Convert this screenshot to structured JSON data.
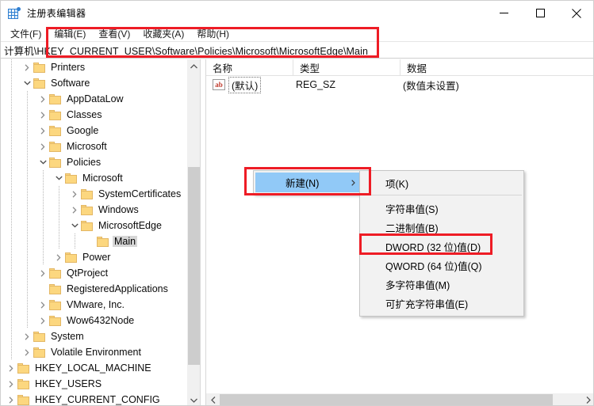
{
  "window": {
    "title": "注册表编辑器",
    "icon": "registry-editor-icon",
    "minimize": "–",
    "maximize": "□",
    "close": "✕"
  },
  "menubar": {
    "items": [
      {
        "label": "文件(F)",
        "name": "menu-file"
      },
      {
        "label": "编辑(E)",
        "name": "menu-edit"
      },
      {
        "label": "查看(V)",
        "name": "menu-view"
      },
      {
        "label": "收藏夹(A)",
        "name": "menu-favorites"
      },
      {
        "label": "帮助(H)",
        "name": "menu-help"
      }
    ]
  },
  "address": {
    "path": "计算机\\HKEY_CURRENT_USER\\Software\\Policies\\Microsoft\\MicrosoftEdge\\Main"
  },
  "tree": {
    "nodes": [
      {
        "label": "Printers",
        "depth": 2,
        "twist": "collapsed",
        "selected": false
      },
      {
        "label": "Software",
        "depth": 2,
        "twist": "expanded",
        "selected": false
      },
      {
        "label": "AppDataLow",
        "depth": 3,
        "twist": "collapsed",
        "selected": false
      },
      {
        "label": "Classes",
        "depth": 3,
        "twist": "collapsed",
        "selected": false
      },
      {
        "label": "Google",
        "depth": 3,
        "twist": "collapsed",
        "selected": false
      },
      {
        "label": "Microsoft",
        "depth": 3,
        "twist": "collapsed",
        "selected": false
      },
      {
        "label": "Policies",
        "depth": 3,
        "twist": "expanded",
        "selected": false
      },
      {
        "label": "Microsoft",
        "depth": 4,
        "twist": "expanded",
        "selected": false
      },
      {
        "label": "SystemCertificates",
        "depth": 5,
        "twist": "collapsed",
        "selected": false
      },
      {
        "label": "Windows",
        "depth": 5,
        "twist": "collapsed",
        "selected": false
      },
      {
        "label": "MicrosoftEdge",
        "depth": 5,
        "twist": "expanded",
        "selected": false
      },
      {
        "label": "Main",
        "depth": 6,
        "twist": "none",
        "selected": true
      },
      {
        "label": "Power",
        "depth": 4,
        "twist": "collapsed",
        "selected": false
      },
      {
        "label": "QtProject",
        "depth": 3,
        "twist": "collapsed",
        "selected": false
      },
      {
        "label": "RegisteredApplications",
        "depth": 3,
        "twist": "none",
        "selected": false
      },
      {
        "label": "VMware, Inc.",
        "depth": 3,
        "twist": "collapsed",
        "selected": false
      },
      {
        "label": "Wow6432Node",
        "depth": 3,
        "twist": "collapsed",
        "selected": false
      },
      {
        "label": "System",
        "depth": 2,
        "twist": "collapsed",
        "selected": false
      },
      {
        "label": "Volatile Environment",
        "depth": 2,
        "twist": "collapsed",
        "selected": false
      },
      {
        "label": "HKEY_LOCAL_MACHINE",
        "depth": 1,
        "twist": "collapsed",
        "selected": false
      },
      {
        "label": "HKEY_USERS",
        "depth": 1,
        "twist": "collapsed",
        "selected": false
      },
      {
        "label": "HKEY_CURRENT_CONFIG",
        "depth": 1,
        "twist": "collapsed",
        "selected": false
      }
    ]
  },
  "value_list": {
    "columns": [
      "名称",
      "类型",
      "数据"
    ],
    "rows": [
      {
        "name": "(默认)",
        "type": "REG_SZ",
        "data": "(数值未设置)",
        "icon": "string-value-icon",
        "icon_text": "ab"
      }
    ]
  },
  "context_menu": {
    "items": [
      {
        "label": "新建(N)",
        "submenu_arrow": "❯",
        "highlighted": true,
        "name": "context-menu-new"
      }
    ]
  },
  "submenu": {
    "items": [
      {
        "label": "项(K)",
        "name": "submenu-item-key",
        "highlighted": false,
        "separator_after": true
      },
      {
        "label": "字符串值(S)",
        "name": "submenu-item-string",
        "highlighted": false,
        "separator_after": false
      },
      {
        "label": "二进制值(B)",
        "name": "submenu-item-binary",
        "highlighted": false,
        "separator_after": false
      },
      {
        "label": "DWORD (32 位)值(D)",
        "name": "submenu-item-dword32",
        "highlighted": true,
        "separator_after": false
      },
      {
        "label": "QWORD (64 位)值(Q)",
        "name": "submenu-item-qword64",
        "highlighted": false,
        "separator_after": false
      },
      {
        "label": "多字符串值(M)",
        "name": "submenu-item-multi-string",
        "highlighted": false,
        "separator_after": false
      },
      {
        "label": "可扩充字符串值(E)",
        "name": "submenu-item-expandable-str",
        "highlighted": false,
        "separator_after": false
      }
    ]
  },
  "annotations": {
    "color": "#ee1c25",
    "boxes": [
      {
        "name": "highlight-address-path",
        "target": "address-path"
      },
      {
        "name": "highlight-new-menu",
        "target": "context-menu-new"
      },
      {
        "name": "highlight-dword-item",
        "target": "submenu-item-dword32"
      }
    ]
  }
}
